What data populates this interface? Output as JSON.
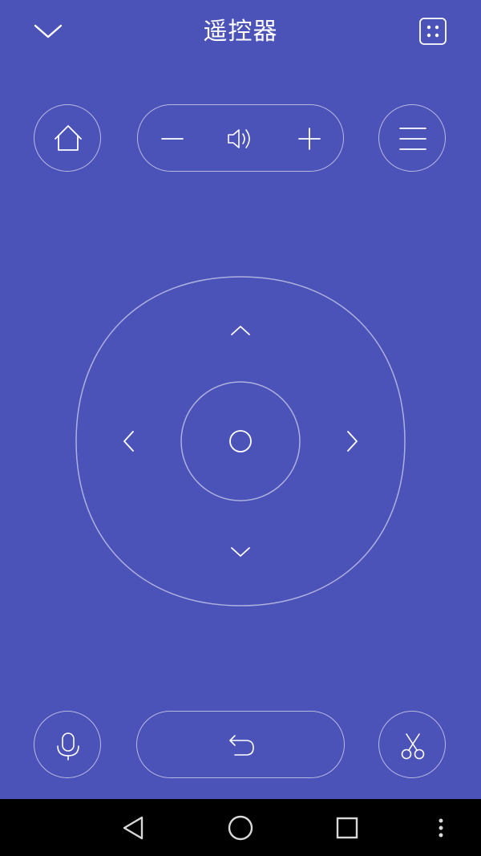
{
  "header": {
    "title": "遥控器"
  },
  "icons": {
    "collapse": "chevron-down-icon",
    "grid": "grid-dots-icon",
    "home": "home-icon",
    "volume_down": "minus-icon",
    "volume": "speaker-icon",
    "volume_up": "plus-icon",
    "menu": "menu-icon",
    "dpad_up": "chevron-up-icon",
    "dpad_down": "chevron-down-icon",
    "dpad_left": "chevron-left-icon",
    "dpad_right": "chevron-right-icon",
    "ok": "circle-icon",
    "voice": "microphone-icon",
    "back": "return-arrow-icon",
    "screenshot": "scissors-icon",
    "nav_back": "triangle-back-icon",
    "nav_home": "circle-home-icon",
    "nav_recents": "square-recents-icon",
    "nav_more": "more-vertical-icon"
  },
  "colors": {
    "background": "#4b52b8",
    "foreground": "#ffffff",
    "navbar": "#000000"
  }
}
